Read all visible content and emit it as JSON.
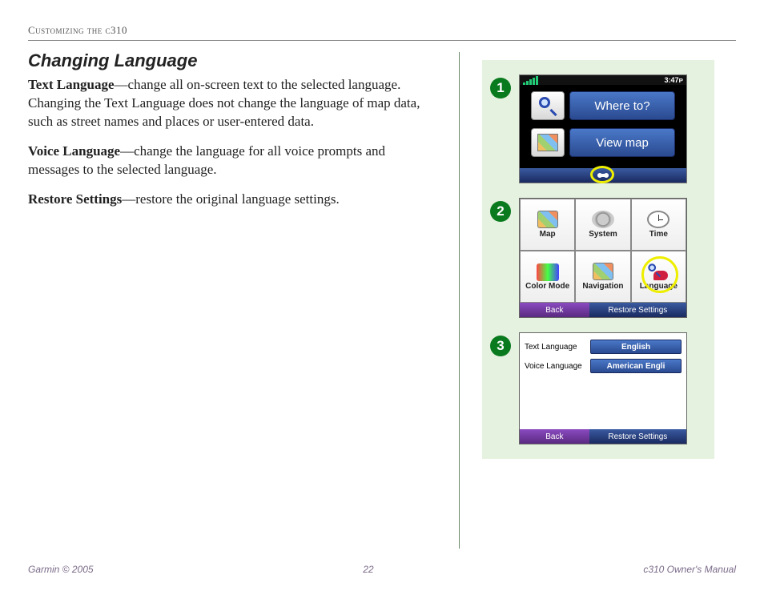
{
  "header": {
    "label": "Customizing the c310"
  },
  "section": {
    "title": "Changing Language",
    "p1_lead": "Text Language",
    "p1_rest": "—change all on-screen text to the selected language. Changing the Text Language does not change the language of map data, such as street names and places or user-entered data.",
    "p2_lead": "Voice Language",
    "p2_rest": "—change the language for all voice prompts and messages to the selected language.",
    "p3_lead": "Restore Settings",
    "p3_rest": "—restore the original language settings."
  },
  "steps": {
    "s1": "1",
    "s2": "2",
    "s3": "3"
  },
  "screen1": {
    "clock": "3:47ᴘ",
    "where_to": "Where to?",
    "view_map": "View map"
  },
  "screen2": {
    "cells": [
      "Map",
      "System",
      "Time",
      "Color Mode",
      "Navigation",
      "Language"
    ],
    "back": "Back",
    "restore": "Restore Settings"
  },
  "screen3": {
    "row1_label": "Text Language",
    "row1_value": "English",
    "row2_label": "Voice Language",
    "row2_value": "American Engli",
    "back": "Back",
    "restore": "Restore Settings"
  },
  "footer": {
    "left": "Garmin © 2005",
    "center": "22",
    "right": "c310 Owner's Manual"
  }
}
